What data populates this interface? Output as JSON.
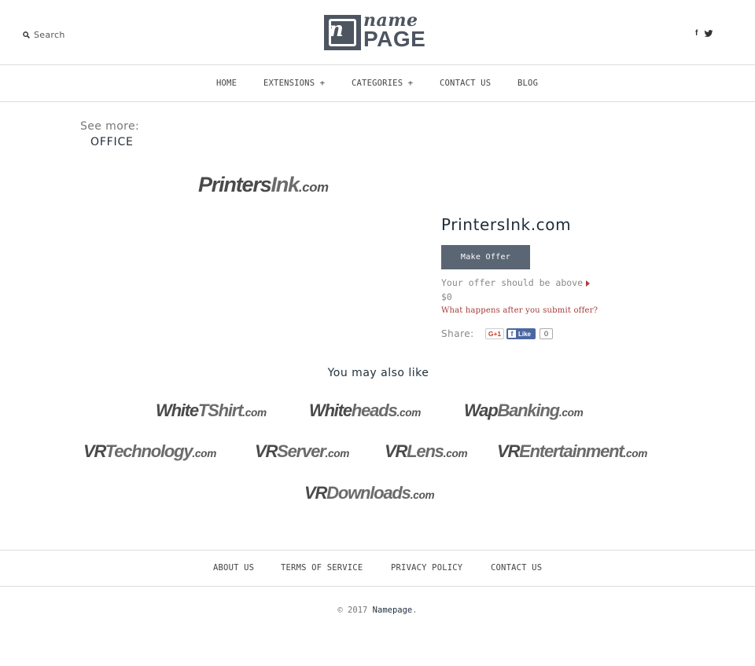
{
  "header": {
    "search_label": "Search",
    "logo": {
      "mark_letter": "n",
      "word1": "name",
      "word2": "PAGE"
    },
    "social": {
      "facebook": "f"
    }
  },
  "nav": {
    "items": [
      {
        "label": "HOME"
      },
      {
        "label": "EXTENSIONS +"
      },
      {
        "label": "CATEGORIES +"
      },
      {
        "label": "CONTACT US"
      },
      {
        "label": "BLOG"
      }
    ]
  },
  "see_more": {
    "label": "See more:",
    "category": "OFFICE"
  },
  "product": {
    "logo": {
      "part1": "Printers",
      "part2": "Ink",
      "tld": ".com"
    },
    "title": "PrintersInk.com",
    "offer_button": "Make Offer",
    "offer_note": "Your offer should be above",
    "offer_min": "$0",
    "help_link": "What happens after you submit offer?",
    "share_label": "Share:",
    "gplus": "G+1",
    "fb_like": "Like",
    "fb_count": "0"
  },
  "related": {
    "title": "You may also like",
    "items": [
      {
        "part1": "White",
        "part2": "TShirt",
        "tld": ".com"
      },
      {
        "part1": "White",
        "part2": "heads",
        "tld": ".com"
      },
      {
        "part1": "Wap",
        "part2": "Banking",
        "tld": ".com"
      },
      {
        "part1": "VR",
        "part2": "Technology",
        "tld": ".com"
      },
      {
        "part1": "VR",
        "part2": "Server",
        "tld": ".com"
      },
      {
        "part1": "VR",
        "part2": "Lens",
        "tld": ".com"
      },
      {
        "part1": "VR",
        "part2": "Entertainment",
        "tld": ".com"
      },
      {
        "part1": "VR",
        "part2": "Downloads",
        "tld": ".com"
      }
    ]
  },
  "footer": {
    "links": [
      {
        "label": "ABOUT US"
      },
      {
        "label": "TERMS OF SERVICE"
      },
      {
        "label": "PRIVACY POLICY"
      },
      {
        "label": "CONTACT US"
      }
    ],
    "copyright_prefix": "© 2017",
    "brand": "Namepage",
    "copyright_suffix": "."
  },
  "colors": {
    "accent": "#5b6674",
    "link_red": "#a33a3a",
    "logo_dark": "#4d5561"
  }
}
